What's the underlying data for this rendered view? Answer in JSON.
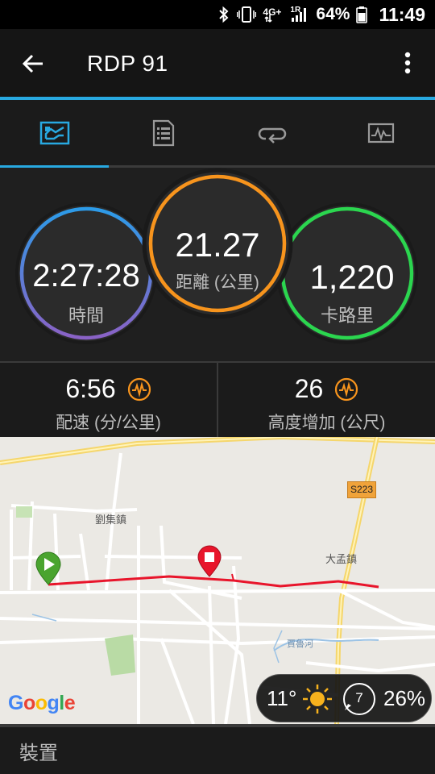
{
  "status_bar": {
    "network_badge": "4G+",
    "signal_badge": "1R",
    "battery_percent": "64%",
    "time": "11:49"
  },
  "app_bar": {
    "title": "RDP 91"
  },
  "tabs": [
    {
      "icon": "stats-icon",
      "active": true
    },
    {
      "icon": "details-list-icon",
      "active": false
    },
    {
      "icon": "laps-loop-icon",
      "active": false
    },
    {
      "icon": "graph-chart-icon",
      "active": false
    }
  ],
  "rings": {
    "time": {
      "value": "2:27:28",
      "label": "時間"
    },
    "distance": {
      "value": "21.27",
      "label": "距離 (公里)"
    },
    "calories": {
      "value": "1,220",
      "label": "卡路里"
    }
  },
  "stats": {
    "pace": {
      "value": "6:56",
      "label": "配速 (分/公里)",
      "icon": "trend-wave-icon"
    },
    "elevation": {
      "value": "26",
      "label": "高度增加 (公尺)",
      "icon": "trend-wave-icon"
    }
  },
  "map": {
    "town_1": "劉集鎮",
    "town_2": "大孟鎮",
    "river": "賈魯河",
    "highway": "S223",
    "google_letters": [
      "G",
      "o",
      "o",
      "g",
      "l",
      "e"
    ],
    "google_colors": [
      "#4285F4",
      "#EA4335",
      "#FBBC05",
      "#4285F4",
      "#34A853",
      "#EA4335"
    ],
    "route_color": "#e8152b",
    "start_marker_color": "#4aa42f",
    "finish_marker_color": "#e8152b"
  },
  "weather": {
    "temperature": "11°",
    "wind_speed": "7",
    "humidity": "26%"
  },
  "device_section": {
    "label": "裝置"
  },
  "colors": {
    "accent_blue": "#28a9e1",
    "ring_orange": "#f7941d",
    "ring_green": "#2bd64f",
    "ring_blue_purple_start": "#2c9be8",
    "ring_blue_purple_end": "#8a62c6",
    "icon_orange": "#f7941d"
  }
}
